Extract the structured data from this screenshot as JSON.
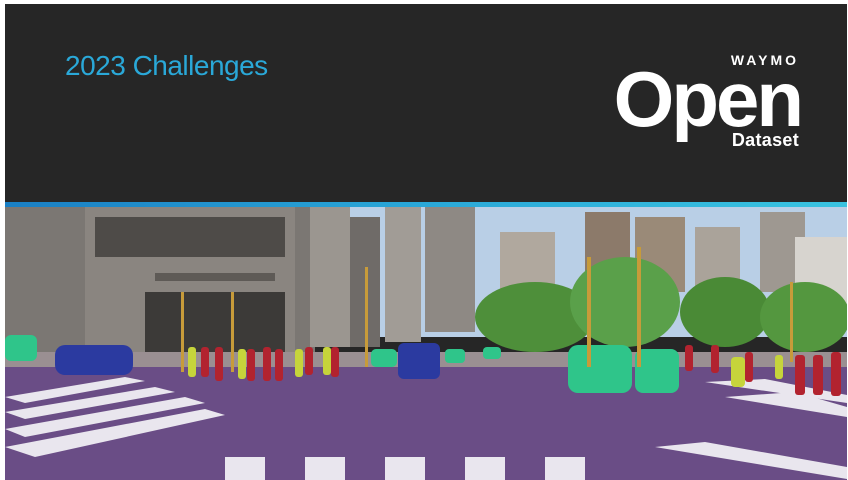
{
  "header": {
    "title": "2023 Challenges"
  },
  "logo": {
    "brand": "WAYMO",
    "main": "Open",
    "sub": "Dataset"
  },
  "colors": {
    "background": "#262626",
    "title": "#2aa8d8",
    "accent": "#2aa8d8",
    "road_segmentation": "#6a4d86",
    "vehicle_green": "#2fc58a",
    "vehicle_blue": "#2b3aa0",
    "pedestrian_red": "#b2232f",
    "cyclist_yellow": "#c6d43b",
    "vegetation": "#4e8f3a",
    "sky": "#b9cfe6"
  },
  "image": {
    "subject": "street-scene-segmentation"
  }
}
